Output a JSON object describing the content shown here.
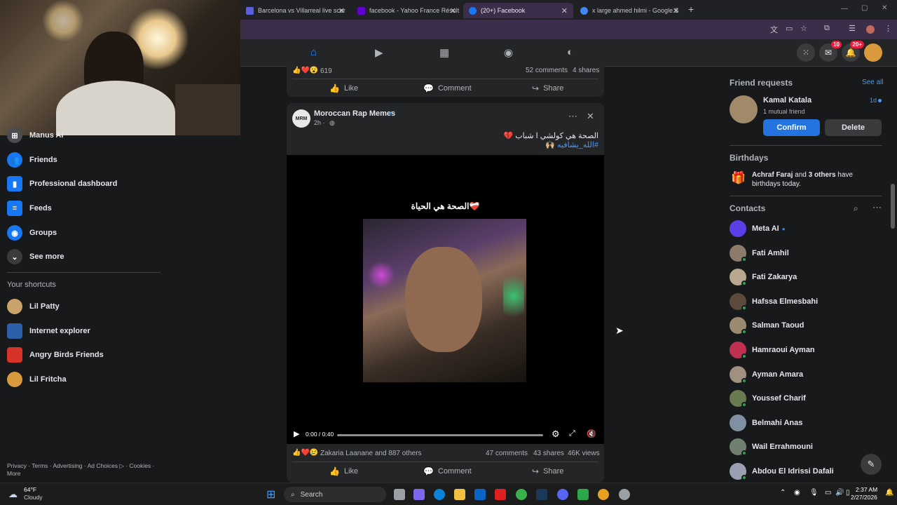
{
  "browser": {
    "tabs": [
      {
        "title": "Barcelona vs Villarreal live scor",
        "color": "#5a5fe0"
      },
      {
        "title": "facebook - Yahoo France Résult",
        "color": "#6001d2"
      },
      {
        "title": "(20+) Facebook",
        "color": "#1877f2"
      },
      {
        "title": "x large ahmed hilmi - Google S",
        "color": "#4285f4"
      }
    ],
    "new_tab": "+"
  },
  "fb_nav": {
    "messenger_badge": "10",
    "notif_badge": "20+"
  },
  "sidebar": {
    "items": [
      {
        "label": "Manus AI",
        "color": "#4b4c4f",
        "icon": "manus-icon"
      },
      {
        "label": "Friends",
        "color": "#1877f2",
        "icon": "friends-icon"
      },
      {
        "label": "Professional dashboard",
        "color": "#1877f2",
        "icon": "dashboard-icon"
      },
      {
        "label": "Feeds",
        "color": "#1877f2",
        "icon": "feeds-icon"
      },
      {
        "label": "Groups",
        "color": "#1877f2",
        "icon": "groups-icon"
      },
      {
        "label": "See more",
        "color": "#3a3b3c",
        "icon": "chevron-down-icon"
      }
    ],
    "shortcuts_title": "Your shortcuts",
    "shortcuts": [
      {
        "label": "Lil Patty",
        "color": "#c9a36a"
      },
      {
        "label": "Internet explorer",
        "color": "#2d5fa8"
      },
      {
        "label": "Angry Birds Friends",
        "color": "#d6342b"
      },
      {
        "label": "Lil Fritcha",
        "color": "#d89a3c"
      }
    ],
    "footer_line1": "Privacy · Terms · Advertising · Ad Choices ▷ · Cookies ·",
    "footer_line2": "More"
  },
  "prev_post": {
    "reactions": "619",
    "comments": "52 comments",
    "shares": "4 shares",
    "like": "Like",
    "comment": "Comment",
    "share": "Share"
  },
  "post": {
    "page_name": "Moroccan Rap Memes",
    "avatar_text": "MRM",
    "time": "2h ·",
    "text_line1": "الصحة هي كولشي ا شباب 💔",
    "text_line2": "#الله_يشافيه 🙌🏼",
    "video_caption": "الصحة هي الحياة❤️‍🩹",
    "video_time": "0:00 / 0:40",
    "video_progress": 0.0,
    "reactions_text": "Zakaria Laanane and 887 others",
    "comments": "47 comments",
    "shares": "43 shares",
    "views": "46K views",
    "like": "Like",
    "comment": "Comment",
    "share": "Share"
  },
  "right": {
    "friend_requests_title": "Friend requests",
    "see_all": "See all",
    "request_name": "Kamal Katala",
    "request_mutual": "1 mutual friend",
    "request_time": "1d",
    "confirm": "Confirm",
    "delete": "Delete",
    "birthdays_title": "Birthdays",
    "birthday_name": "Achraf Faraj",
    "birthday_and": " and ",
    "birthday_others": "3 others",
    "birthday_rest": " have birthdays today.",
    "contacts_title": "Contacts",
    "contacts": [
      {
        "name": "Meta AI",
        "color": "#5b3ee6",
        "online": false
      },
      {
        "name": "Fati Amhil",
        "color": "#8c7b6a",
        "online": true
      },
      {
        "name": "Fati Zakarya",
        "color": "#b8a890",
        "online": true
      },
      {
        "name": "Hafssa Elmesbahi",
        "color": "#5c4a3c",
        "online": true
      },
      {
        "name": "Salman Taoud",
        "color": "#9a8a70",
        "online": true
      },
      {
        "name": "Hamraoui Ayman",
        "color": "#c03050",
        "online": true
      },
      {
        "name": "Ayman Amara",
        "color": "#a09080",
        "online": true
      },
      {
        "name": "Youssef Charif",
        "color": "#6a7a50",
        "online": true
      },
      {
        "name": "Belmahi Anas",
        "color": "#8090a0",
        "online": false
      },
      {
        "name": "Wail Errahmouni",
        "color": "#708070",
        "online": true
      },
      {
        "name": "Abdou El Idrissi Dafali",
        "color": "#9aa0b0",
        "online": true
      }
    ]
  },
  "taskbar": {
    "weather_temp": "64°F",
    "weather_desc": "Cloudy",
    "search": "Search",
    "time": "2:37 AM",
    "date": "2/27/2026"
  }
}
